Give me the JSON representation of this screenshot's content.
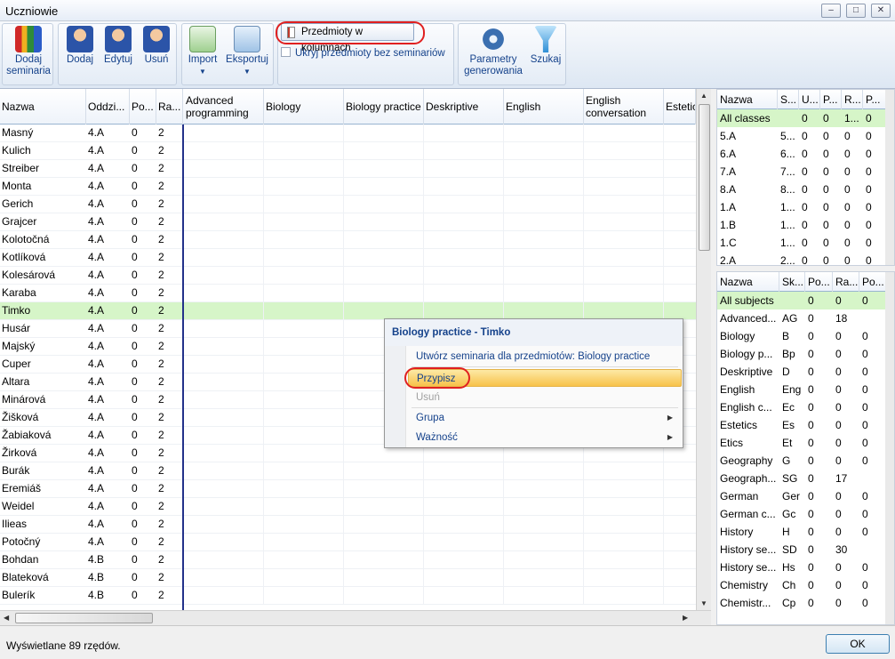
{
  "window": {
    "title": "Uczniowie"
  },
  "ribbon": {
    "add_seminars": "Dodaj seminaria",
    "add": "Dodaj",
    "edit": "Edytuj",
    "delete": "Usuń",
    "import": "Import",
    "export": "Eksportuj",
    "subjects_in_columns": "Przedmioty w kolumnach",
    "hide_subjects_without_seminars": "Ukryj przedmioty bez seminariów",
    "generation_params": "Parametry generowania",
    "search": "Szukaj"
  },
  "grid": {
    "columns": [
      "Nazwa",
      "Oddzi...",
      "Po...",
      "Ra..."
    ],
    "subject_columns": [
      "Advanced programming",
      "Biology",
      "Biology practice",
      "Deskriptive",
      "English",
      "English conversation",
      "Estetic"
    ],
    "rows": [
      [
        "Masný",
        "4.A",
        "0",
        "2"
      ],
      [
        "Kulich",
        "4.A",
        "0",
        "2"
      ],
      [
        "Streiber",
        "4.A",
        "0",
        "2"
      ],
      [
        "Monta",
        "4.A",
        "0",
        "2"
      ],
      [
        "Gerich",
        "4.A",
        "0",
        "2"
      ],
      [
        "Grajcer",
        "4.A",
        "0",
        "2"
      ],
      [
        "Kolotočná",
        "4.A",
        "0",
        "2"
      ],
      [
        "Kotlíková",
        "4.A",
        "0",
        "2"
      ],
      [
        "Kolesárová",
        "4.A",
        "0",
        "2"
      ],
      [
        "Karaba",
        "4.A",
        "0",
        "2"
      ],
      [
        "Timko",
        "4.A",
        "0",
        "2"
      ],
      [
        "Husár",
        "4.A",
        "0",
        "2"
      ],
      [
        "Majský",
        "4.A",
        "0",
        "2"
      ],
      [
        "Cuper",
        "4.A",
        "0",
        "2"
      ],
      [
        "Altara",
        "4.A",
        "0",
        "2"
      ],
      [
        "Minárová",
        "4.A",
        "0",
        "2"
      ],
      [
        "Žišková",
        "4.A",
        "0",
        "2"
      ],
      [
        "Žabiaková",
        "4.A",
        "0",
        "2"
      ],
      [
        "Žirková",
        "4.A",
        "0",
        "2"
      ],
      [
        "Burák",
        "4.A",
        "0",
        "2"
      ],
      [
        "Eremiáš",
        "4.A",
        "0",
        "2"
      ],
      [
        "Weidel",
        "4.A",
        "0",
        "2"
      ],
      [
        "Ilieas",
        "4.A",
        "0",
        "2"
      ],
      [
        "Potočný",
        "4.A",
        "0",
        "2"
      ],
      [
        "Bohdan",
        "4.B",
        "0",
        "2"
      ],
      [
        "Blateková",
        "4.B",
        "0",
        "2"
      ],
      [
        "Bulerík",
        "4.B",
        "0",
        "2"
      ]
    ]
  },
  "classes_panel": {
    "columns": [
      "Nazwa",
      "S...",
      "U...",
      "P...",
      "R...",
      "P..."
    ],
    "rows": [
      [
        "All classes",
        "",
        "0",
        "0",
        "1...",
        "0"
      ],
      [
        "5.A",
        "5...",
        "0",
        "0",
        "0",
        "0"
      ],
      [
        "6.A",
        "6...",
        "0",
        "0",
        "0",
        "0"
      ],
      [
        "7.A",
        "7...",
        "0",
        "0",
        "0",
        "0"
      ],
      [
        "8.A",
        "8...",
        "0",
        "0",
        "0",
        "0"
      ],
      [
        "1.A",
        "1...",
        "0",
        "0",
        "0",
        "0"
      ],
      [
        "1.B",
        "1...",
        "0",
        "0",
        "0",
        "0"
      ],
      [
        "1.C",
        "1...",
        "0",
        "0",
        "0",
        "0"
      ],
      [
        "2.A",
        "2...",
        "0",
        "0",
        "0",
        "0"
      ]
    ]
  },
  "subjects_panel": {
    "columns": [
      "Nazwa",
      "Sk...",
      "Po...",
      "Ra...",
      "Po..."
    ],
    "rows": [
      [
        "All subjects",
        "",
        "0",
        "0",
        "0"
      ],
      [
        "Advanced...",
        "AG",
        "0",
        "18",
        ""
      ],
      [
        "Biology",
        "B",
        "0",
        "0",
        "0"
      ],
      [
        "Biology p...",
        "Bp",
        "0",
        "0",
        "0"
      ],
      [
        "Deskriptive",
        "D",
        "0",
        "0",
        "0"
      ],
      [
        "English",
        "Eng",
        "0",
        "0",
        "0"
      ],
      [
        "English c...",
        "Ec",
        "0",
        "0",
        "0"
      ],
      [
        "Estetics",
        "Es",
        "0",
        "0",
        "0"
      ],
      [
        "Etics",
        "Et",
        "0",
        "0",
        "0"
      ],
      [
        "Geography",
        "G",
        "0",
        "0",
        "0"
      ],
      [
        "Geograph...",
        "SG",
        "0",
        "17",
        ""
      ],
      [
        "German",
        "Ger",
        "0",
        "0",
        "0"
      ],
      [
        "German c...",
        "Gc",
        "0",
        "0",
        "0"
      ],
      [
        "History",
        "H",
        "0",
        "0",
        "0"
      ],
      [
        "History se...",
        "SD",
        "0",
        "30",
        ""
      ],
      [
        "History se...",
        "Hs",
        "0",
        "0",
        "0"
      ],
      [
        "Chemistry",
        "Ch",
        "0",
        "0",
        "0"
      ],
      [
        "Chemistr...",
        "Cp",
        "0",
        "0",
        "0"
      ]
    ]
  },
  "context_menu": {
    "title": "Biology practice - Timko",
    "items": [
      "Utwórz seminaria dla przedmiotów: Biology practice",
      "Przypisz",
      "Usuń",
      "Grupa",
      "Ważność"
    ]
  },
  "status": {
    "text": "Wyświetlane 89 rzędów.",
    "ok": "OK"
  },
  "colors": {
    "selected_row": "#d6f5c8",
    "highlight": "#e02020",
    "accent": "#15428b"
  }
}
